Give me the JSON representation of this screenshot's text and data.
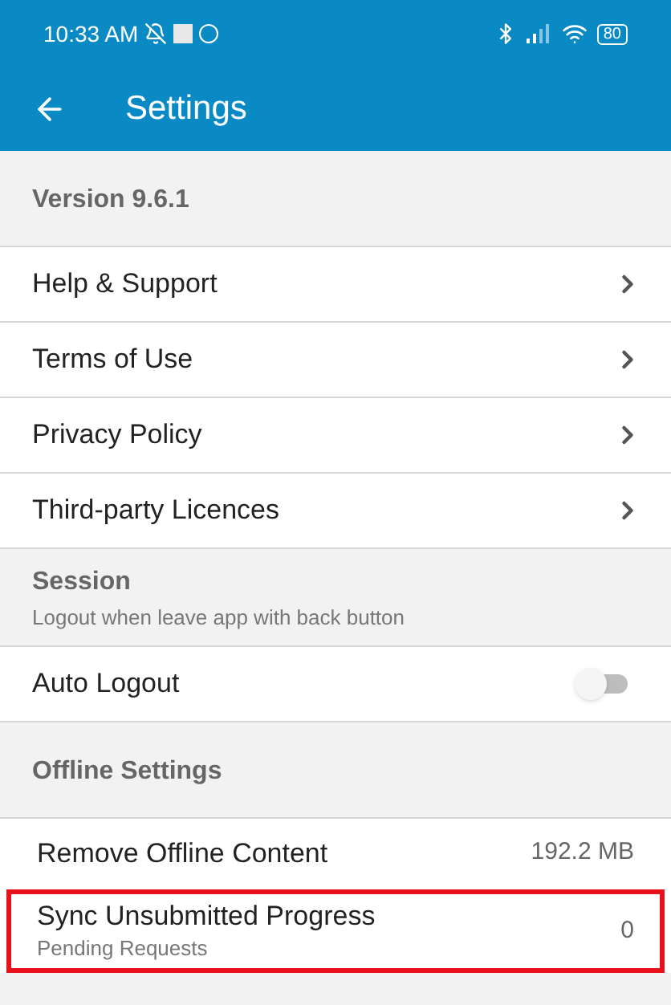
{
  "status_bar": {
    "time": "10:33 AM",
    "battery": "80"
  },
  "app_bar": {
    "title": "Settings"
  },
  "items": [
    {
      "kind": "header",
      "title": "Version 9.6.1"
    },
    {
      "kind": "link",
      "title": "Help & Support"
    },
    {
      "kind": "link",
      "title": "Terms of Use"
    },
    {
      "kind": "link",
      "title": "Privacy Policy"
    },
    {
      "kind": "link",
      "title": "Third-party Licences"
    },
    {
      "kind": "header",
      "title": "Session",
      "subtitle": "Logout when leave app with back button"
    },
    {
      "kind": "toggle",
      "title": "Auto Logout",
      "on": false
    },
    {
      "kind": "header",
      "title": "Offline Settings"
    },
    {
      "kind": "value",
      "title": "Remove Offline Content",
      "value": "192.2 MB",
      "highlighted": false
    },
    {
      "kind": "value",
      "title": "Sync Unsubmitted Progress",
      "subtitle": "Pending Requests",
      "value": "0",
      "highlighted": true
    }
  ]
}
